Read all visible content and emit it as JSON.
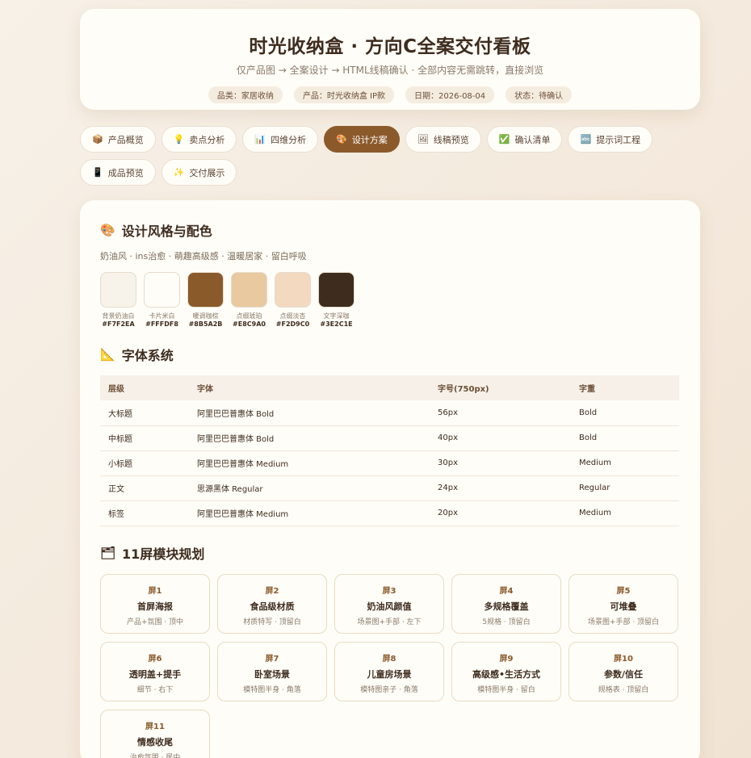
{
  "header": {
    "title": "时光收纳盒 · 方向C全案交付看板",
    "subtitle": "仅产品图 → 全案设计 → HTML线稿确认 · 全部内容无需跳转，直接浏览",
    "tags": [
      "品类：家居收纳",
      "产品：时光收纳盒 IP款",
      "日期：2026-08-04",
      "状态：待确认"
    ]
  },
  "nav": [
    {
      "icon": "📦",
      "icon_name": "package-icon",
      "label": "产品概览"
    },
    {
      "icon": "💡",
      "icon_name": "lightbulb-icon",
      "label": "卖点分析"
    },
    {
      "icon": "📊",
      "icon_name": "bar-chart-icon",
      "label": "四维分析"
    },
    {
      "icon": "🎨",
      "icon_name": "palette-icon",
      "label": "设计方案",
      "active": true
    },
    {
      "icon": "🖼",
      "icon_name": "picture-icon",
      "label": "线稿预览"
    },
    {
      "icon": "✅",
      "icon_name": "check-icon",
      "label": "确认清单"
    },
    {
      "icon": "🔤",
      "icon_name": "abc-icon",
      "label": "提示词工程"
    },
    {
      "icon": "📱",
      "icon_name": "phone-icon",
      "label": "成品预览"
    },
    {
      "icon": "✨",
      "icon_name": "sparkle-icon",
      "label": "交付展示"
    }
  ],
  "style_section": {
    "icon": "🎨",
    "title": "设计风格与配色",
    "description": "奶油风 · ins治愈 · 萌趣高级感 · 温暖居家 · 留白呼吸",
    "swatches": [
      {
        "name": "背景奶油白",
        "hex": "#F7F2EA"
      },
      {
        "name": "卡片米白",
        "hex": "#FFFDF8"
      },
      {
        "name": "暖调咖棕",
        "hex": "#8B5A2B"
      },
      {
        "name": "点缀琥珀",
        "hex": "#E8C9A0"
      },
      {
        "name": "点缀淡杏",
        "hex": "#F2D9C0"
      },
      {
        "name": "文字深咖",
        "hex": "#3E2C1E"
      }
    ]
  },
  "font_section": {
    "icon": "📐",
    "title": "字体系统",
    "headers": [
      "层级",
      "字体",
      "字号(750px)",
      "字重"
    ],
    "rows": [
      [
        "大标题",
        "阿里巴巴普惠体 Bold",
        "56px",
        "Bold"
      ],
      [
        "中标题",
        "阿里巴巴普惠体 Bold",
        "40px",
        "Bold"
      ],
      [
        "小标题",
        "阿里巴巴普惠体 Medium",
        "30px",
        "Medium"
      ],
      [
        "正文",
        "思源黑体 Regular",
        "24px",
        "Regular"
      ],
      [
        "标签",
        "阿里巴巴普惠体 Medium",
        "20px",
        "Medium"
      ]
    ]
  },
  "module_section": {
    "icon": "🗂",
    "title": "11屏模块规划",
    "modules": [
      {
        "num": "屏1",
        "title": "首屏海报",
        "desc": "产品+氛围 · 顶中"
      },
      {
        "num": "屏2",
        "title": "食品级材质",
        "desc": "材质特写 · 顶留白"
      },
      {
        "num": "屏3",
        "title": "奶油风颜值",
        "desc": "场景图+手部 · 左下"
      },
      {
        "num": "屏4",
        "title": "多规格覆盖",
        "desc": "5规格 · 顶留白"
      },
      {
        "num": "屏5",
        "title": "可堆叠",
        "desc": "场景图+手部 · 顶留白"
      },
      {
        "num": "屏6",
        "title": "透明盖+提手",
        "desc": "细节 · 右下"
      },
      {
        "num": "屏7",
        "title": "卧室场景",
        "desc": "模特图半身 · 角落"
      },
      {
        "num": "屏8",
        "title": "儿童房场景",
        "desc": "模特图亲子 · 角落"
      },
      {
        "num": "屏9",
        "title": "高级感•生活方式",
        "desc": "模特图半身 · 留白"
      },
      {
        "num": "屏10",
        "title": "参数/信任",
        "desc": "规格表 · 顶留白"
      },
      {
        "num": "屏11",
        "title": "情感收尾",
        "desc": "治愈氛围 · 居中"
      }
    ]
  }
}
